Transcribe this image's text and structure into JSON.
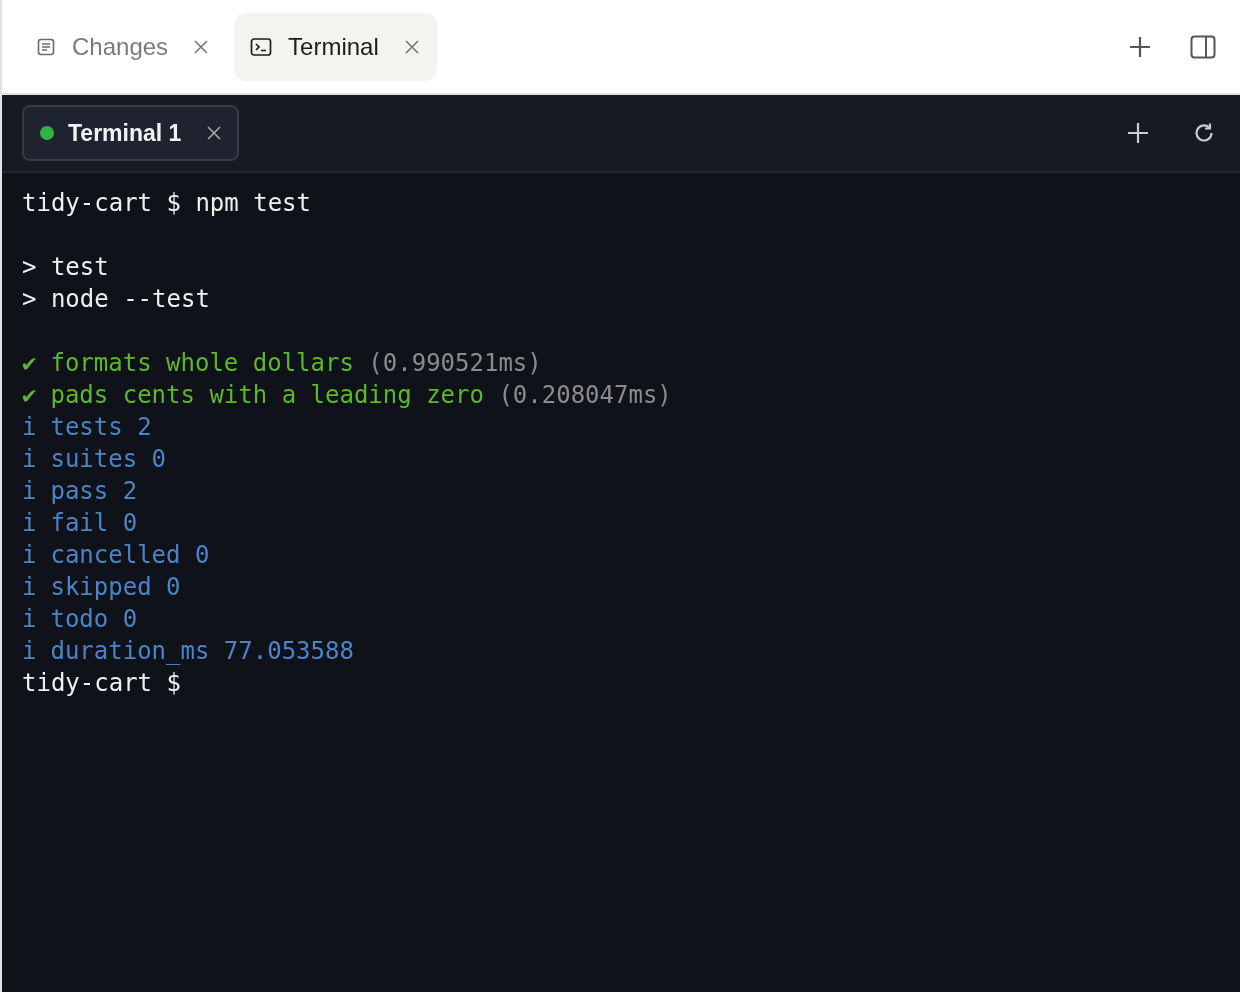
{
  "tabs": [
    {
      "label": "Changes",
      "kind": "document",
      "selected": false
    },
    {
      "label": "Terminal",
      "kind": "terminal",
      "selected": true
    }
  ],
  "terminal_tabs": [
    {
      "label": "Terminal 1",
      "color": "#2fb344",
      "selected": true
    }
  ],
  "terminal_output": [
    {
      "kind": "command",
      "text": "tidy-cart $ npm test"
    },
    {
      "kind": "blank"
    },
    {
      "kind": "plain",
      "text": "> test"
    },
    {
      "kind": "plain",
      "text": "> node --test"
    },
    {
      "kind": "blank"
    },
    {
      "kind": "pass",
      "mark": "✔",
      "text": "formats whole dollars",
      "duration": "(0.990521ms)"
    },
    {
      "kind": "pass",
      "mark": "✔",
      "text": "pads cents with a leading zero",
      "duration": "(0.208047ms)"
    },
    {
      "kind": "info",
      "mark": "i",
      "text": "tests 2"
    },
    {
      "kind": "info",
      "mark": "i",
      "text": "suites 0"
    },
    {
      "kind": "info",
      "mark": "i",
      "text": "pass 2"
    },
    {
      "kind": "info",
      "mark": "i",
      "text": "fail 0"
    },
    {
      "kind": "info",
      "mark": "i",
      "text": "cancelled 0"
    },
    {
      "kind": "info",
      "mark": "i",
      "text": "skipped 0"
    },
    {
      "kind": "info",
      "mark": "i",
      "text": "todo 0"
    },
    {
      "kind": "info",
      "mark": "i",
      "text": "duration_ms 77.053588"
    },
    {
      "kind": "command",
      "text": "tidy-cart $"
    }
  ]
}
